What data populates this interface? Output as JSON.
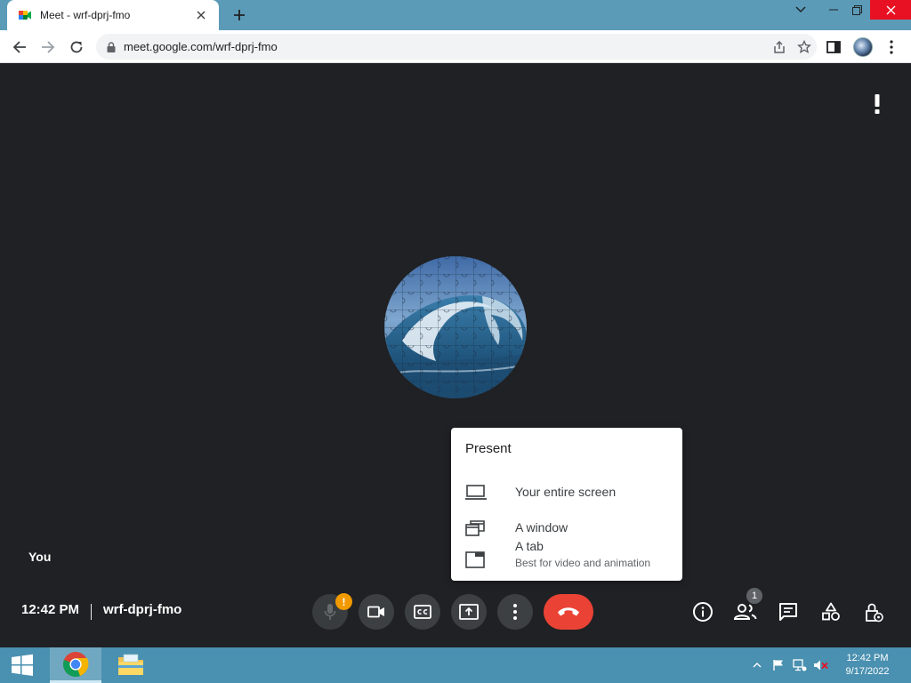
{
  "browser": {
    "tab_title": "Meet - wrf-dprj-fmo",
    "url": "meet.google.com/wrf-dprj-fmo",
    "icons": {
      "favicon": "google-meet-icon",
      "tab_close": "close-icon",
      "new_tab": "plus-icon",
      "back": "arrow-left-icon",
      "forward": "arrow-right-icon",
      "reload": "reload-icon",
      "lock": "lock-icon",
      "share": "share-icon",
      "bookmark": "star-icon",
      "side_panel": "side-panel-icon",
      "menu": "kebab-menu-icon"
    }
  },
  "meet": {
    "self_label": "You",
    "time": "12:42 PM",
    "meeting_code": "wrf-dprj-fmo",
    "mic_alert_badge": "!",
    "people_count": "1",
    "present_menu": {
      "title": "Present",
      "items": [
        {
          "label": "Your entire screen",
          "sublabel": "",
          "icon": "monitor-icon"
        },
        {
          "label": "A window",
          "sublabel": "",
          "icon": "window-icon"
        },
        {
          "label": "A tab",
          "sublabel": "Best for video and animation",
          "icon": "tab-icon"
        }
      ]
    },
    "controls": [
      "mic-off-icon",
      "camera-icon",
      "captions-icon",
      "present-icon",
      "more-options-icon",
      "end-call-icon"
    ],
    "side_controls": [
      "info-icon",
      "people-icon",
      "chat-icon",
      "activities-icon",
      "host-controls-icon"
    ]
  },
  "taskbar": {
    "clock_time": "12:42 PM",
    "clock_date": "9/17/2022",
    "apps": [
      "chrome-icon",
      "file-explorer-icon"
    ]
  },
  "colors": {
    "stage_bg": "#202124",
    "leave_red": "#ea4335",
    "tabbar_blue": "#5b9bb8",
    "taskbar_blue": "#4a90b0",
    "alert_orange": "#f29900"
  }
}
